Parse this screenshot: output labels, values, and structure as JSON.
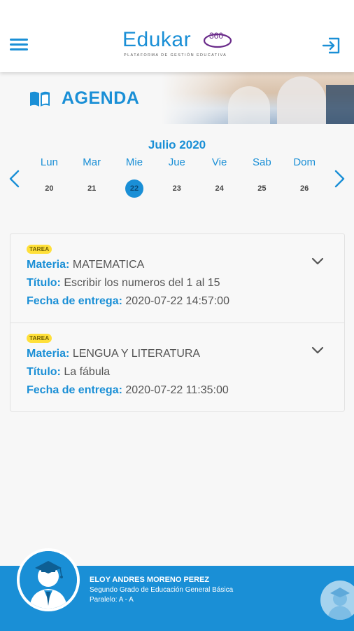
{
  "header": {
    "menu_icon": "hamburger-menu-icon",
    "logo_text": "Edukar",
    "logo_number": "360",
    "logo_subtitle": "PLATAFORMA DE GESTIÓN EDUCATIVA",
    "logout_icon": "logout-icon"
  },
  "banner": {
    "title": "AGENDA",
    "icon": "book-icon"
  },
  "calendar": {
    "month_label": "Julio 2020",
    "days": [
      {
        "name": "Lun",
        "number": "20"
      },
      {
        "name": "Mar",
        "number": "21"
      },
      {
        "name": "Mie",
        "number": "22"
      },
      {
        "name": "Jue",
        "number": "23"
      },
      {
        "name": "Vie",
        "number": "24"
      },
      {
        "name": "Sab",
        "number": "25"
      },
      {
        "name": "Dom",
        "number": "26"
      }
    ],
    "selected_day": "22"
  },
  "tasks": [
    {
      "badge": "TAREA",
      "materia_label": "Materia:",
      "materia": "MATEMATICA",
      "titulo_label": "Título:",
      "titulo": "Escribir los numeros del 1 al 15",
      "fecha_label": "Fecha de entrega:",
      "fecha": "2020-07-22 14:57:00"
    },
    {
      "badge": "TAREA",
      "materia_label": "Materia:",
      "materia": "LENGUA Y LITERATURA",
      "titulo_label": "Título:",
      "titulo": "La fábula",
      "fecha_label": "Fecha de entrega:",
      "fecha": "2020-07-22 11:35:00"
    }
  ],
  "footer": {
    "student_name": "ELOY ANDRES MORENO PEREZ",
    "grade": "Segundo Grado de Educación General Básica",
    "paralelo": "Paralelo: A - A"
  },
  "colors": {
    "primary": "#1a8fd6",
    "badge": "#ffe03a",
    "logo_accent": "#6a2b8a"
  }
}
